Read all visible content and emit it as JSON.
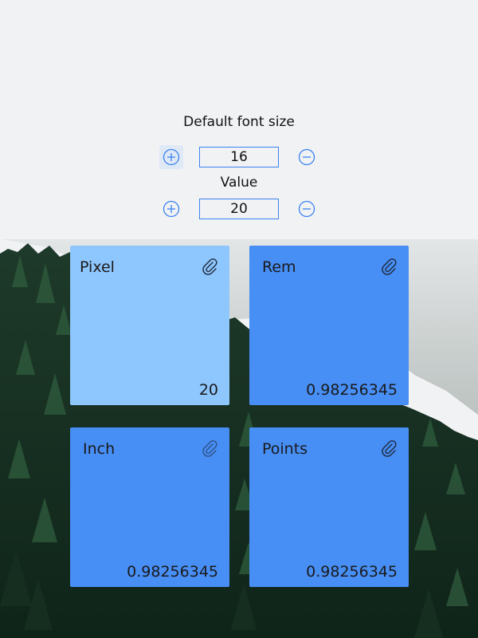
{
  "controls": {
    "font_size": {
      "label": "Default font size",
      "value": "16"
    },
    "value": {
      "label": "Value",
      "value": "20"
    }
  },
  "cards": [
    {
      "title": "Pixel",
      "value": "20"
    },
    {
      "title": "Rem",
      "value": "0.98256345"
    },
    {
      "title": "Inch",
      "value": "0.98256345"
    },
    {
      "title": "Points",
      "value": "0.98256345"
    }
  ],
  "icons": {
    "increment": "plus-circle-icon",
    "decrement": "minus-circle-icon",
    "copy": "paperclip-icon"
  },
  "colors": {
    "accent": "#3b82f0",
    "card_active": "#8ec6fe",
    "card": "#478ef5",
    "background": "#f1f2f4"
  }
}
